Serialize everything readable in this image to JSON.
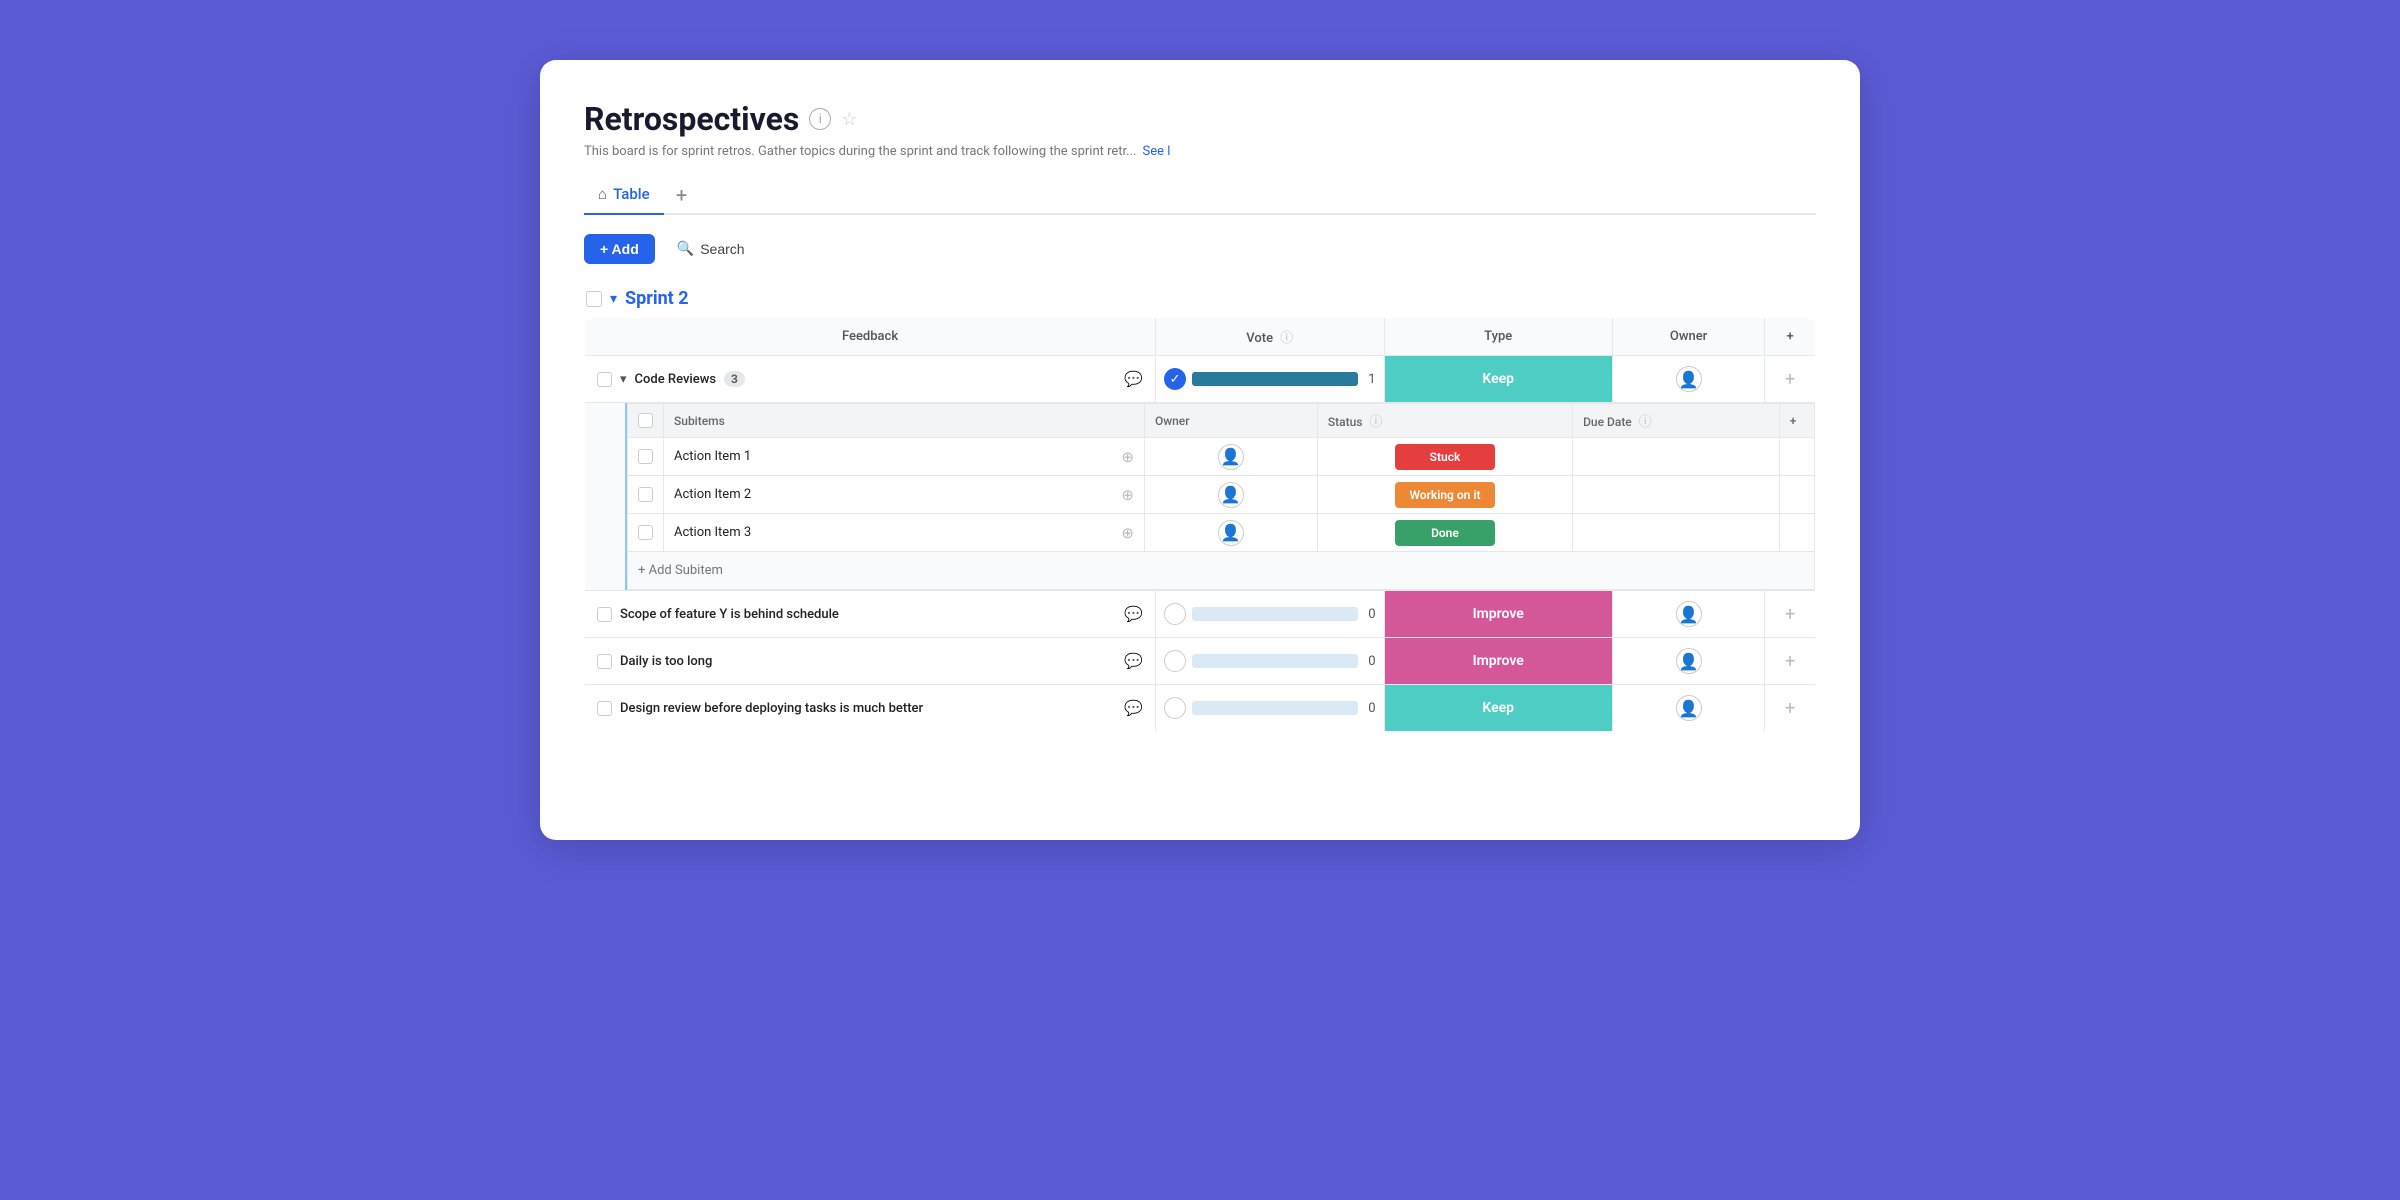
{
  "page": {
    "title": "Retrospectives",
    "description": "This board is for sprint retros. Gather topics during the sprint and track following the sprint retr...",
    "see_more": "See l",
    "info_icon": "ℹ",
    "star_icon": "☆"
  },
  "tabs": [
    {
      "label": "Table",
      "active": true,
      "icon": "⌂"
    }
  ],
  "tab_add_label": "+",
  "toolbar": {
    "add_label": "+ Add",
    "search_label": "Search"
  },
  "sprint": {
    "title": "Sprint 2",
    "checkbox": "",
    "chevron": "▾"
  },
  "table": {
    "columns": {
      "feedback": "Feedback",
      "vote": "Vote",
      "type": "Type",
      "owner": "Owner",
      "add": "+"
    }
  },
  "code_reviews": {
    "name": "Code Reviews",
    "count": "3",
    "vote_count": "1",
    "type": "Keep",
    "type_class": "keep"
  },
  "subitems": {
    "col_subitems": "Subitems",
    "col_owner": "Owner",
    "col_status": "Status",
    "col_due_date": "Due Date",
    "items": [
      {
        "name": "Action Item 1",
        "status": "Stuck",
        "status_class": "stuck"
      },
      {
        "name": "Action Item 2",
        "status": "Working on it",
        "status_class": "working"
      },
      {
        "name": "Action Item 3",
        "status": "Done",
        "status_class": "done"
      }
    ],
    "add_label": "+ Add Subitem"
  },
  "rows": [
    {
      "feedback": "Scope of feature Y is behind schedule",
      "vote_count": "0",
      "type": "Improve",
      "type_class": "improve"
    },
    {
      "feedback": "Daily is too long",
      "vote_count": "0",
      "type": "Improve",
      "type_class": "improve"
    },
    {
      "feedback": "Design review before deploying tasks is much better",
      "vote_count": "0",
      "type": "Keep",
      "type_class": "keep"
    }
  ]
}
